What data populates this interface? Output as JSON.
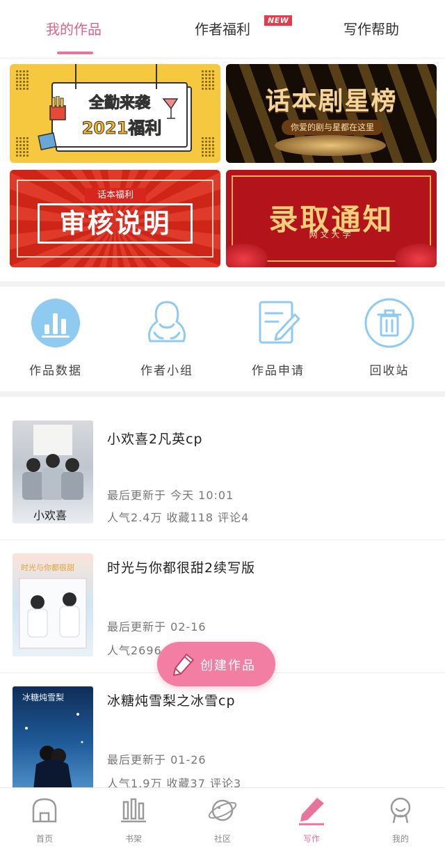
{
  "tabs": [
    {
      "label": "我的作品",
      "active": true
    },
    {
      "label": "作者福利",
      "badge": "NEW"
    },
    {
      "label": "写作帮助"
    }
  ],
  "banners": {
    "b1": {
      "line1": "全勤来袭",
      "line2": "2021福利"
    },
    "b2": {
      "title": "话本剧星榜",
      "subtitle": "你爱的剧与星都在这里"
    },
    "b3": {
      "sub": "话本福利",
      "title": "审核说明"
    },
    "b4": {
      "title": "录取通知",
      "subtitle": "网文大学"
    }
  },
  "quick_actions": [
    {
      "label": "作品数据",
      "icon": "bar-chart-icon"
    },
    {
      "label": "作者小组",
      "icon": "group-icon"
    },
    {
      "label": "作品申请",
      "icon": "edit-document-icon"
    },
    {
      "label": "回收站",
      "icon": "trash-icon"
    }
  ],
  "works": [
    {
      "title": "小欢喜2凡英cp",
      "updated": "最后更新于 今天 10:01",
      "stats": "人气2.4万 收藏118 评论4"
    },
    {
      "title": "时光与你都很甜2续写版",
      "updated": "最后更新于 02-16",
      "stats": "人气2696 收藏"
    },
    {
      "title": "冰糖炖雪梨之冰雪cp",
      "updated": "最后更新于 01-26",
      "stats": "人气1.9万 收藏37 评论3"
    }
  ],
  "fab": {
    "label": "创建作品"
  },
  "bottom_nav": [
    {
      "label": "首页"
    },
    {
      "label": "书架"
    },
    {
      "label": "社区"
    },
    {
      "label": "写作",
      "active": true
    },
    {
      "label": "我的"
    }
  ],
  "colors": {
    "accent": "#e8739b",
    "icon_blue": "#7cc0e8",
    "fab": "#f37ea3"
  }
}
